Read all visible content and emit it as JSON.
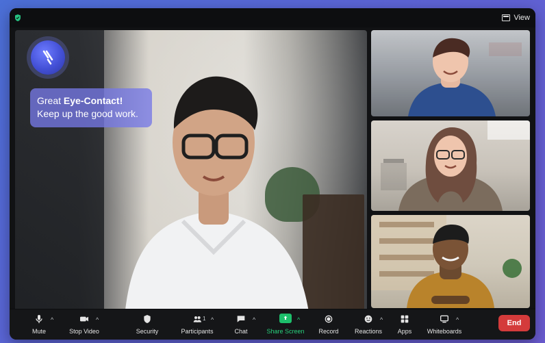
{
  "app": {
    "view_label": "View"
  },
  "overlay": {
    "bubble_prefix": "Great ",
    "bubble_bold": "Eye-Contact!",
    "bubble_line2": "Keep up the good work."
  },
  "toolbar": {
    "items": [
      {
        "key": "mute",
        "label": "Mute",
        "icon": "microphone-icon",
        "has_caret": true
      },
      {
        "key": "stop_video",
        "label": "Stop Video",
        "icon": "video-camera-icon",
        "has_caret": true
      },
      {
        "key": "security",
        "label": "Security",
        "icon": "shield-icon",
        "has_caret": false
      },
      {
        "key": "participants",
        "label": "Participants",
        "icon": "participants-icon",
        "has_caret": true,
        "count": "1"
      },
      {
        "key": "chat",
        "label": "Chat",
        "icon": "chat-icon",
        "has_caret": true
      },
      {
        "key": "share_screen",
        "label": "Share Screen",
        "icon": "share-screen-icon",
        "has_caret": true
      },
      {
        "key": "record",
        "label": "Record",
        "icon": "record-icon",
        "has_caret": false
      },
      {
        "key": "reactions",
        "label": "Reactions",
        "icon": "reactions-icon",
        "has_caret": true
      },
      {
        "key": "apps",
        "label": "Apps",
        "icon": "apps-icon",
        "has_caret": false
      },
      {
        "key": "whiteboards",
        "label": "Whiteboards",
        "icon": "whiteboard-icon",
        "has_caret": true
      }
    ],
    "end_label": "End"
  },
  "colors": {
    "accent_green": "#1dbf6b",
    "end_red": "#d43b3b",
    "bubble_bg": "#7678e6"
  }
}
